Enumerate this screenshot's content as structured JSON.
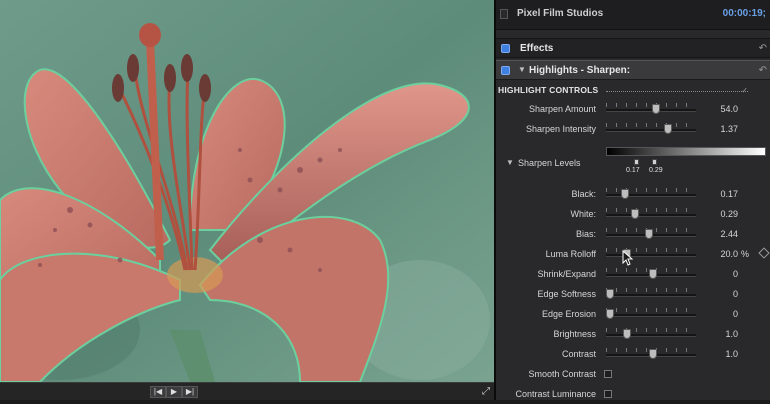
{
  "viewer": {
    "transport": {
      "prev_label": "|◀",
      "play_label": "▶",
      "next_label": "▶|",
      "fullscreen_label": "⤢"
    }
  },
  "inspector": {
    "studio_name": "Pixel Film Studios",
    "timecode": "00:00:19;",
    "effects_label": "Effects",
    "highlights_label": "Highlights - Sharpen:",
    "highlight_controls_label": "HIGHLIGHT CONTROLS",
    "top_params": [
      {
        "label": "Sharpen Amount",
        "value": "54.0",
        "level": 0.54
      },
      {
        "label": "Sharpen Intensity",
        "value": "1.37",
        "level": 0.68
      }
    ],
    "levels": {
      "label": "Sharpen Levels",
      "black_value": "0.17",
      "white_value": "0.29"
    },
    "params": [
      {
        "label": "Black:",
        "value": "0.17",
        "level": 0.17,
        "unit": ""
      },
      {
        "label": "White:",
        "value": "0.29",
        "level": 0.29,
        "unit": ""
      },
      {
        "label": "Bias:",
        "value": "2.44",
        "level": 0.45,
        "unit": ""
      },
      {
        "label": "Luma Rolloff",
        "value": "20.0",
        "level": 0.2,
        "unit": "%"
      },
      {
        "label": "Shrink/Expand",
        "value": "0",
        "level": 0.5,
        "unit": ""
      },
      {
        "label": "Edge Softness",
        "value": "0",
        "level": 0.0,
        "unit": ""
      },
      {
        "label": "Edge Erosion",
        "value": "0",
        "level": 0.0,
        "unit": ""
      },
      {
        "label": "Brightness",
        "value": "1.0",
        "level": 0.2,
        "unit": ""
      },
      {
        "label": "Contrast",
        "value": "1.0",
        "level": 0.5,
        "unit": ""
      }
    ],
    "checkboxes": [
      {
        "label": "Smooth Contrast",
        "checked": false
      },
      {
        "label": "Contrast Luminance",
        "checked": false
      }
    ]
  },
  "colors": {
    "accent": "#3f7fe0",
    "timecode": "#6aa0e8",
    "panel_bg": "#29292b"
  }
}
